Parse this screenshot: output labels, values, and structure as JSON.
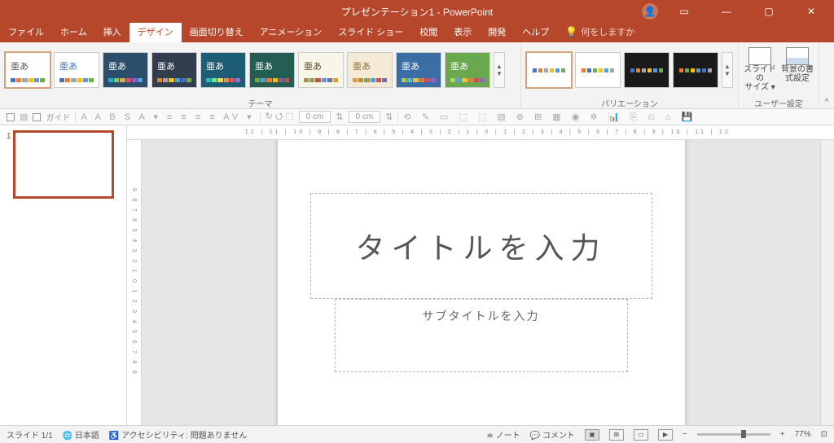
{
  "titlebar": {
    "title": "プレゼンテーション1  -  PowerPoint"
  },
  "tabs": {
    "items": [
      "ファイル",
      "ホーム",
      "挿入",
      "デザイン",
      "画面切り替え",
      "アニメーション",
      "スライド ショー",
      "校閲",
      "表示",
      "開発",
      "ヘルプ"
    ],
    "active_index": 3,
    "tell_me": "何をしますか"
  },
  "ribbon": {
    "theme_label": "テーマ",
    "variation_label": "バリエーション",
    "custom_label": "ユーザー設定",
    "slide_size": "スライドの\nサイズ ▾",
    "format_bg": "背景の書\n式設定",
    "theme_text": "亜あ",
    "theme_colors": [
      {
        "bg": "#ffffff",
        "txt": "#555",
        "strip": [
          "#4472c4",
          "#ed7d31",
          "#a5a5a5",
          "#ffc000",
          "#5b9bd5",
          "#70ad47"
        ]
      },
      {
        "bg": "#ffffff",
        "txt": "#4472c4",
        "strip": [
          "#4472c4",
          "#ed7d31",
          "#a5a5a5",
          "#ffc000",
          "#5b9bd5",
          "#70ad47"
        ]
      },
      {
        "bg": "#2d4e6b",
        "txt": "#fff",
        "strip": [
          "#1cade4",
          "#7cca62",
          "#f9a23c",
          "#e24f66",
          "#9b57d3",
          "#4ea6dc"
        ]
      },
      {
        "bg": "#323e4f",
        "txt": "#fff",
        "strip": [
          "#ed7d31",
          "#a5a5a5",
          "#ffc000",
          "#5b9bd5",
          "#4472c4",
          "#70ad47"
        ]
      },
      {
        "bg": "#1e5e75",
        "txt": "#fff",
        "strip": [
          "#31b6c9",
          "#6feb8c",
          "#f9d649",
          "#f38b3c",
          "#e24f66",
          "#a26bd1"
        ]
      },
      {
        "bg": "#245d52",
        "txt": "#fff",
        "strip": [
          "#70ad47",
          "#5b9bd5",
          "#ed7d31",
          "#ffc000",
          "#8064a2",
          "#c0504d"
        ]
      },
      {
        "bg": "#f8f6e9",
        "txt": "#5a4a2e",
        "strip": [
          "#b58b4c",
          "#8a9b52",
          "#c2504d",
          "#5b9bd5",
          "#7d6b9e",
          "#d8a13e"
        ]
      },
      {
        "bg": "#f4ead6",
        "txt": "#8a6d3b",
        "strip": [
          "#d8a13e",
          "#b58b4c",
          "#8a9b52",
          "#5b9bd5",
          "#c2504d",
          "#7d6b9e"
        ]
      },
      {
        "bg": "#3b6ea5",
        "txt": "#fff",
        "strip": [
          "#a8ce4d",
          "#5cb8d6",
          "#f3c232",
          "#ee7c30",
          "#d14b63",
          "#9a62c7"
        ]
      },
      {
        "bg": "#6aa84f",
        "txt": "#fff",
        "strip": [
          "#b3d465",
          "#4fa8d8",
          "#f3c232",
          "#ee7c30",
          "#d14b63",
          "#9a62c7"
        ]
      }
    ],
    "variations": [
      {
        "bg": "#ffffff",
        "dots": [
          "#4472c4",
          "#ed7d31",
          "#a5a5a5",
          "#ffc000",
          "#5b9bd5",
          "#70ad47"
        ]
      },
      {
        "bg": "#ffffff",
        "dots": [
          "#ed7d31",
          "#4472c4",
          "#70ad47",
          "#ffc000",
          "#5b9bd5",
          "#a5a5a5"
        ]
      },
      {
        "bg": "#1a1a1a",
        "dots": [
          "#4472c4",
          "#ed7d31",
          "#a5a5a5",
          "#ffc000",
          "#5b9bd5",
          "#70ad47"
        ]
      },
      {
        "bg": "#1a1a1a",
        "dots": [
          "#ed7d31",
          "#70ad47",
          "#ffc000",
          "#5b9bd5",
          "#4472c4",
          "#a5a5a5"
        ]
      }
    ]
  },
  "minitoolbar": {
    "guide_label": "ガイド",
    "cm1": "0 cm",
    "cm2": "0 cm"
  },
  "slide": {
    "title_placeholder": "タイトルを入力",
    "subtitle_placeholder": "サブタイトルを入力",
    "number": "1"
  },
  "ruler": {
    "h": "12 | 11 | 10 | 9 | 8 | 7 | 6 | 5 | 4 | 3 | 2 | 1 | 0 | 1 | 2 | 3 | 4 | 5 | 6 | 7 | 8 | 9 | 10 | 11 | 12",
    "v": "9 8 7 6 5 4 3 2 1 0 1 2 3 4 5 6 7 8 9"
  },
  "statusbar": {
    "slide_count": "スライド 1/1",
    "language": "日本語",
    "accessibility": "アクセシビリティ: 問題ありません",
    "notes": "ノート",
    "comments": "コメント",
    "zoom": "77%"
  }
}
